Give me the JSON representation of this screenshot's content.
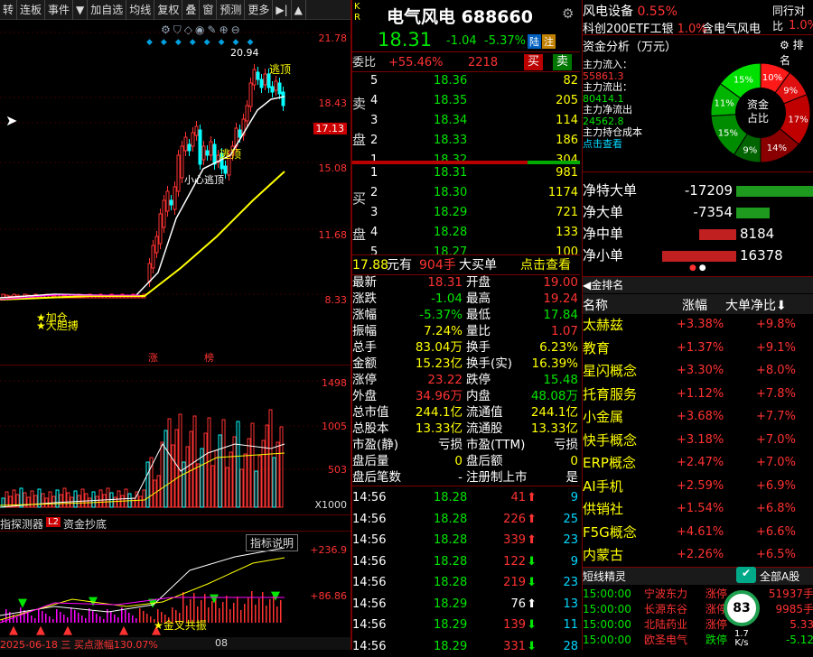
{
  "toolbar": {
    "items": [
      "转",
      "连板",
      "事件",
      "▼",
      "加自选",
      "均线",
      "复权",
      "叠",
      "窗",
      "预测",
      "更多",
      "▶|",
      "▲"
    ]
  },
  "kline": {
    "price_axis": [
      "21.78",
      "18.43",
      "17.13",
      "15.08",
      "11.68",
      "8.33"
    ],
    "labels": {
      "high": "20.94",
      "top_tag": "逃顶",
      "mid_tag": "逃顶",
      "mid_note": "小心逃顶",
      "add_pos": "加仓",
      "big_bold": "大胆搏",
      "zhang": "涨",
      "bang": "榜"
    }
  },
  "volume": {
    "axis": [
      "1498",
      "1005",
      "503",
      "X1000"
    ]
  },
  "indicator": {
    "tab1": "指探测器",
    "tab2_badge": "L2",
    "tab2": "资金抄底",
    "explain": "指标说明",
    "axis": [
      "+236.9",
      "+86.86"
    ],
    "signal": "金叉共振",
    "date": "2025-06-18 三 买点涨幅130.07%",
    "date_short": "08"
  },
  "quote": {
    "title": "电气风电",
    "code": "688660",
    "markers": [
      "K",
      "R"
    ],
    "price": "18.31",
    "change": "-1.04",
    "pct": "-5.37%",
    "tag1": "陆",
    "tag2": "注",
    "weibi_label": "委比",
    "weibi": "+55.46%",
    "weicha": "2218",
    "buy_btn": "买",
    "sell_btn": "卖",
    "sell_label": [
      "卖",
      "盘"
    ],
    "buy_label": [
      "买",
      "盘"
    ],
    "asks": [
      {
        "n": "5",
        "p": "18.36",
        "v": "82"
      },
      {
        "n": "4",
        "p": "18.35",
        "v": "205"
      },
      {
        "n": "3",
        "p": "18.34",
        "v": "114"
      },
      {
        "n": "2",
        "p": "18.33",
        "v": "186"
      },
      {
        "n": "1",
        "p": "18.32",
        "v": "304"
      }
    ],
    "bids": [
      {
        "n": "1",
        "p": "18.31",
        "v": "981"
      },
      {
        "n": "2",
        "p": "18.30",
        "v": "1174"
      },
      {
        "n": "3",
        "p": "18.29",
        "v": "721"
      },
      {
        "n": "4",
        "p": "18.28",
        "v": "133"
      },
      {
        "n": "5",
        "p": "18.27",
        "v": "100"
      }
    ],
    "bigbuy": {
      "price": "17.88",
      "yuan": "元有",
      "qty": "904手",
      "label": "大买单",
      "link": "点击查看"
    },
    "stats": [
      {
        "l": "最新",
        "v": "18.31",
        "c": "red",
        "l2": "开盘",
        "v2": "19.00",
        "c2": "red"
      },
      {
        "l": "涨跌",
        "v": "-1.04",
        "c": "grn",
        "l2": "最高",
        "v2": "19.24",
        "c2": "red"
      },
      {
        "l": "涨幅",
        "v": "-5.37%",
        "c": "grn",
        "l2": "最低",
        "v2": "17.84",
        "c2": "grn"
      },
      {
        "l": "振幅",
        "v": "7.24%",
        "c": "yel",
        "l2": "量比",
        "v2": "1.07",
        "c2": "red"
      },
      {
        "l": "总手",
        "v": "83.04万",
        "c": "yel",
        "l2": "换手",
        "v2": "6.23%",
        "c2": "yel"
      },
      {
        "l": "金额",
        "v": "15.23亿",
        "c": "yel",
        "l2": "换手(实)",
        "v2": "16.39%",
        "c2": "yel"
      },
      {
        "l": "涨停",
        "v": "23.22",
        "c": "red",
        "l2": "跌停",
        "v2": "15.48",
        "c2": "grn"
      },
      {
        "l": "外盘",
        "v": "34.96万",
        "c": "red",
        "l2": "内盘",
        "v2": "48.08万",
        "c2": "grn"
      },
      {
        "l": "总市值",
        "v": "244.1亿",
        "c": "yel",
        "l2": "流通值",
        "v2": "244.1亿",
        "c2": "yel"
      },
      {
        "l": "总股本",
        "v": "13.33亿",
        "c": "yel",
        "l2": "流通股",
        "v2": "13.33亿",
        "c2": "yel"
      },
      {
        "l": "市盈(静)",
        "v": "亏损",
        "c": "wht",
        "l2": "市盈(TTM)",
        "v2": "亏损",
        "c2": "wht"
      },
      {
        "l": "盘后量",
        "v": "0",
        "c": "yel",
        "l2": "盘后额",
        "v2": "0",
        "c2": "yel"
      },
      {
        "l": "盘后笔数",
        "v": "-",
        "c": "wht",
        "l2": "注册制上市",
        "v2": "是",
        "c2": "wht"
      }
    ],
    "ticks": [
      {
        "t": "14:56",
        "p": "18.28",
        "v": "41",
        "d": "up",
        "n": "9"
      },
      {
        "t": "14:56",
        "p": "18.28",
        "v": "226",
        "d": "up",
        "n": "25"
      },
      {
        "t": "14:56",
        "p": "18.28",
        "v": "339",
        "d": "up",
        "n": "23"
      },
      {
        "t": "14:56",
        "p": "18.28",
        "v": "122",
        "d": "dn",
        "n": "9"
      },
      {
        "t": "14:56",
        "p": "18.28",
        "v": "219",
        "d": "dn",
        "n": "23"
      },
      {
        "t": "14:56",
        "p": "18.29",
        "v": "76",
        "d": "upw",
        "n": "13"
      },
      {
        "t": "14:56",
        "p": "18.29",
        "v": "139",
        "d": "dn",
        "n": "11"
      },
      {
        "t": "14:56",
        "p": "18.29",
        "v": "331",
        "d": "dn",
        "n": "28"
      }
    ]
  },
  "sector": {
    "name": "风电设备",
    "pct": "0.55%",
    "peer": "同行对比",
    "etf": "科创200ETF工银",
    "etf_pct": "1.0%",
    "contains": "含电气风电",
    "etf2_pct": "1.0%"
  },
  "capital": {
    "title": "资金分析（万元）",
    "rank": "排名",
    "inflow_label": "主力流入：",
    "inflow": "55861.3",
    "outflow_label": "主力流出：",
    "outflow": "80414.1",
    "net_label": "主力净流出",
    "net": "24562.8",
    "cost_label": "主力持仓成本",
    "link": "点击查看",
    "pie_center": [
      "资金",
      "占比"
    ],
    "pie": [
      {
        "pct": 10,
        "color": "#ff1a1a",
        "label": "10%"
      },
      {
        "pct": 9,
        "color": "#e01010",
        "label": "9%"
      },
      {
        "pct": 17,
        "color": "#c00000",
        "label": "17%"
      },
      {
        "pct": 14,
        "color": "#8a0000",
        "label": "14%"
      },
      {
        "pct": 9,
        "color": "#006400",
        "label": "9%"
      },
      {
        "pct": 15,
        "color": "#008c00",
        "label": "15%"
      },
      {
        "pct": 11,
        "color": "#00b400",
        "label": "11%"
      },
      {
        "pct": 15,
        "color": "#00e000",
        "label": "15%"
      }
    ]
  },
  "flows": [
    {
      "label": "净特大单",
      "value": "-17209",
      "amount": -17209
    },
    {
      "label": "净大单",
      "value": "-7354",
      "amount": -7354
    },
    {
      "label": "净中单",
      "value": "8184",
      "amount": 8184
    },
    {
      "label": "净小单",
      "value": "16378",
      "amount": 16378
    }
  ],
  "rank": {
    "title": "金排名",
    "cols": [
      "名称",
      "涨幅",
      "大单净比"
    ],
    "rows": [
      {
        "n": "太赫兹",
        "a": "+3.38%",
        "b": "+9.8%"
      },
      {
        "n": "教育",
        "a": "+1.37%",
        "b": "+9.1%"
      },
      {
        "n": "星闪概念",
        "a": "+3.30%",
        "b": "+8.0%"
      },
      {
        "n": "托育服务",
        "a": "+1.12%",
        "b": "+7.8%"
      },
      {
        "n": "小金属",
        "a": "+3.68%",
        "b": "+7.7%"
      },
      {
        "n": "快手概念",
        "a": "+3.18%",
        "b": "+7.0%"
      },
      {
        "n": "ERP概念",
        "a": "+2.47%",
        "b": "+7.0%"
      },
      {
        "n": "AI手机",
        "a": "+2.59%",
        "b": "+6.9%"
      },
      {
        "n": "供销社",
        "a": "+1.54%",
        "b": "+6.8%"
      },
      {
        "n": "F5G概念",
        "a": "+4.61%",
        "b": "+6.6%"
      },
      {
        "n": "内蒙古",
        "a": "+2.26%",
        "b": "+6.5%"
      }
    ]
  },
  "news": {
    "title": "短线精灵",
    "filter": "全部A股",
    "score": "83",
    "speed": "1.7",
    "speed_unit": "K/s",
    "rows": [
      {
        "t": "15:00:00",
        "s": "宁波东力",
        "e": "涨停",
        "v": "51937手"
      },
      {
        "t": "15:00:00",
        "s": "长源东谷",
        "e": "涨停",
        "v": "9985手"
      },
      {
        "t": "15:00:00",
        "s": "北陆药业",
        "e": "涨停",
        "v": "5.33"
      },
      {
        "t": "15:00:00",
        "s": "欧圣电气",
        "e": "跌停",
        "v": "-5.12"
      }
    ]
  }
}
